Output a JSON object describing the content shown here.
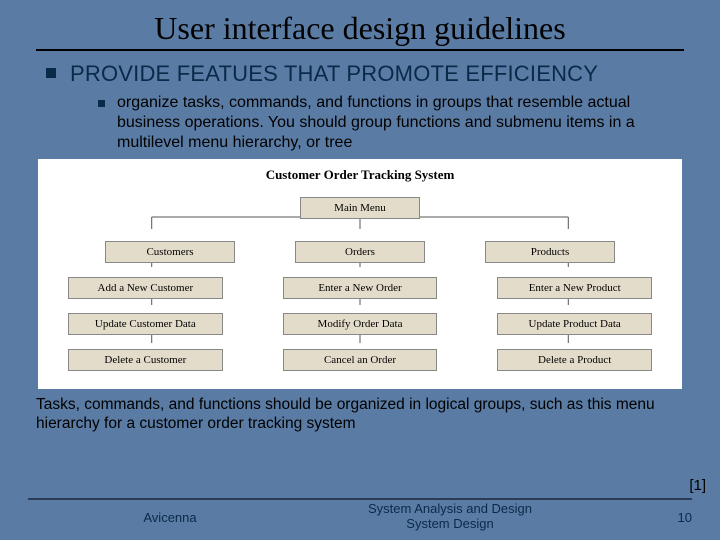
{
  "title": "User interface design guidelines",
  "bullet1": "PROVIDE FEATUES THAT PROMOTE EFFICIENCY",
  "bullet2": "organize tasks, commands, and functions in groups that resemble actual business operations. You should group functions and submenu items in a multilevel menu hierarchy, or tree",
  "chart_data": {
    "type": "tree",
    "title": "Customer Order Tracking System",
    "root": "Main Menu",
    "columns": [
      {
        "header": "Customers",
        "items": [
          "Add a New Customer",
          "Update Customer Data",
          "Delete a Customer"
        ]
      },
      {
        "header": "Orders",
        "items": [
          "Enter a New Order",
          "Modify Order Data",
          "Cancel an Order"
        ]
      },
      {
        "header": "Products",
        "items": [
          "Enter a New Product",
          "Update Product Data",
          "Delete a Product"
        ]
      }
    ]
  },
  "caption": "Tasks, commands, and functions should be organized in logical groups, such as this menu hierarchy for a customer order tracking system",
  "reference": "[1]",
  "footer": {
    "left": "Avicenna",
    "center_line1": "System Analysis and Design",
    "center_line2": "System Design",
    "right": "10"
  }
}
